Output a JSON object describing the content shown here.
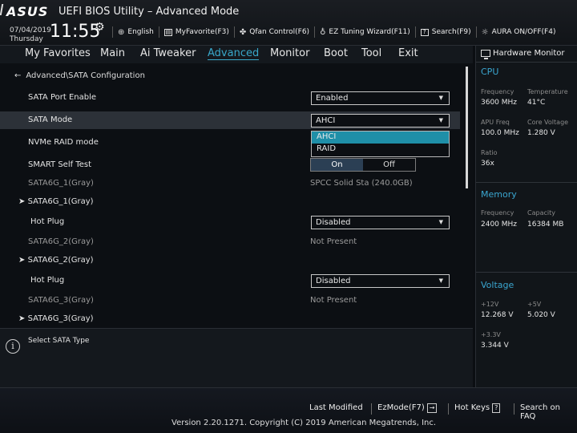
{
  "header": {
    "brand": "ASUS",
    "title": "UEFI BIOS Utility – Advanced Mode",
    "date": "07/04/2019",
    "weekday": "Thursday",
    "time": "11:55",
    "tools": [
      {
        "label": "English",
        "icon": "globe-icon"
      },
      {
        "label": "MyFavorite(F3)",
        "icon": "favorite-icon"
      },
      {
        "label": "Qfan Control(F6)",
        "icon": "fan-icon"
      },
      {
        "label": "EZ Tuning Wizard(F11)",
        "icon": "bulb-icon"
      },
      {
        "label": "Search(F9)",
        "icon": "search-icon"
      },
      {
        "label": "AURA ON/OFF(F4)",
        "icon": "aura-icon"
      }
    ]
  },
  "menu": {
    "items": [
      "My Favorites",
      "Main",
      "Ai Tweaker",
      "Advanced",
      "Monitor",
      "Boot",
      "Tool",
      "Exit"
    ],
    "active": "Advanced"
  },
  "main": {
    "breadcrumb": "Advanced\\SATA Configuration",
    "rows": {
      "sata_port_enable": {
        "label": "SATA Port Enable",
        "value": "Enabled"
      },
      "sata_mode": {
        "label": "SATA Mode",
        "value": "AHCI"
      },
      "nvme_raid": {
        "label": "NVMe RAID mode"
      },
      "smart": {
        "label": "SMART Self Test",
        "on": "On",
        "off": "Off"
      },
      "sata1": {
        "label": "SATA6G_1(Gray)",
        "value": "SPCC Solid Sta (240.0GB)"
      },
      "sata1_expand": {
        "label": "SATA6G_1(Gray)"
      },
      "hotplug1": {
        "label": "Hot Plug",
        "value": "Disabled"
      },
      "sata2": {
        "label": "SATA6G_2(Gray)",
        "value": "Not Present"
      },
      "sata2_expand": {
        "label": "SATA6G_2(Gray)"
      },
      "hotplug2": {
        "label": "Hot Plug",
        "value": "Disabled"
      },
      "sata3": {
        "label": "SATA6G_3(Gray)",
        "value": "Not Present"
      },
      "sata3_expand": {
        "label": "SATA6G_3(Gray)"
      }
    },
    "dropdown_options": [
      "AHCI",
      "RAID"
    ],
    "dropdown_highlighted": "AHCI"
  },
  "help": {
    "text": "Select SATA Type"
  },
  "hardware_monitor": {
    "title": "Hardware Monitor",
    "cpu": {
      "title": "CPU",
      "frequency_label": "Frequency",
      "frequency": "3600 MHz",
      "temperature_label": "Temperature",
      "temperature": "41°C",
      "apu_freq_label": "APU Freq",
      "apu_freq": "100.0 MHz",
      "core_voltage_label": "Core Voltage",
      "core_voltage": "1.280 V",
      "ratio_label": "Ratio",
      "ratio": "36x"
    },
    "memory": {
      "title": "Memory",
      "frequency_label": "Frequency",
      "frequency": "2400 MHz",
      "capacity_label": "Capacity",
      "capacity": "16384 MB"
    },
    "voltage": {
      "title": "Voltage",
      "v12_label": "+12V",
      "v12": "12.268 V",
      "v5_label": "+5V",
      "v5": "5.020 V",
      "v33_label": "+3.3V",
      "v33": "3.344 V"
    }
  },
  "footer": {
    "last_modified": "Last Modified",
    "ezmode": "EzMode(F7)",
    "ezmode_icon": "→",
    "hotkeys": "Hot Keys",
    "hotkeys_icon": "?",
    "search_faq": "Search on FAQ",
    "copyright": "Version 2.20.1271. Copyright (C) 2019 American Megatrends, Inc."
  },
  "colors": {
    "accent": "#39a7c9",
    "dropdown_highlight": "#1f8fa8",
    "background": "#0b0e12"
  }
}
